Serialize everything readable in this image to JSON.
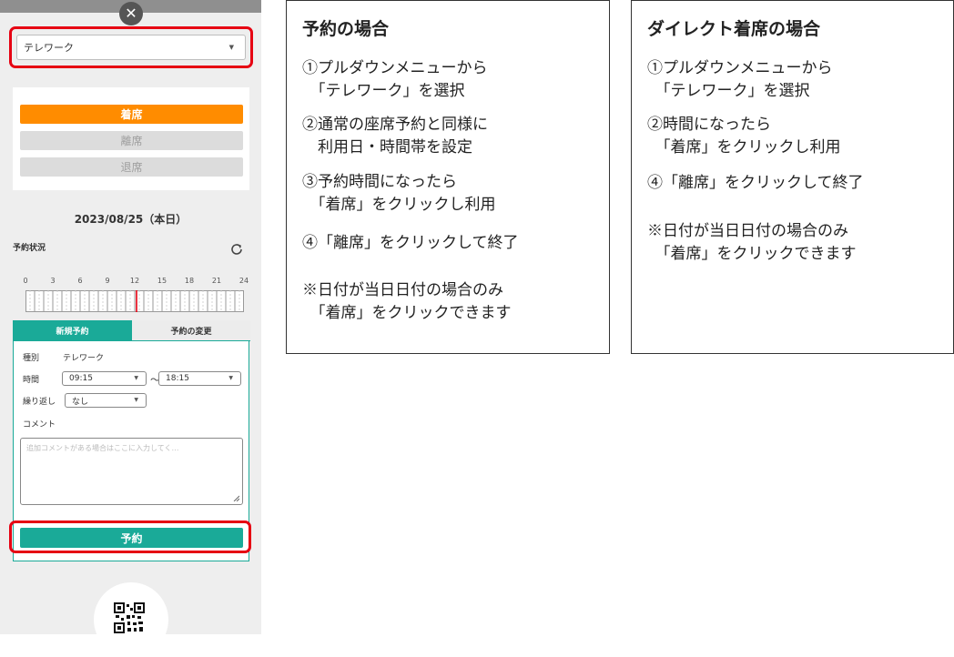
{
  "app": {
    "close_icon": "close-icon",
    "status_select": {
      "value": "テレワーク"
    },
    "seat_buttons": {
      "checkin": "着席",
      "leave": "離席",
      "exit": "退席"
    },
    "date": "2023/08/25（本日）",
    "reservation_status_heading": "予約状況",
    "timeline": {
      "ticks": [
        "0",
        "3",
        "6",
        "9",
        "12",
        "15",
        "18",
        "21",
        "24"
      ],
      "current_hour": 12.2
    },
    "tabs": {
      "new": "新規予約",
      "change": "予約の変更"
    },
    "form": {
      "type_label": "種別",
      "type_value": "テレワーク",
      "time_label": "時間",
      "start_time": "09:15",
      "tilde": "～",
      "end_time": "18:15",
      "repeat_label": "繰り返し",
      "repeat_value": "なし",
      "comment_label": "コメント",
      "comment_placeholder": "追加コメントがある場合はここに入力してく…"
    },
    "reserve_button": "予約",
    "qr_icon": "qr-code-icon"
  },
  "colors": {
    "accent_teal": "#1aaa98",
    "checkin_orange": "#ff8c00",
    "highlight_red": "#e60012"
  },
  "instructions": {
    "reservation": {
      "title": "予約の場合",
      "steps": [
        "①プルダウンメニューから\n　「テレワーク」を選択",
        "②通常の座席予約と同様に\n　利用日・時間帯を設定",
        "③予約時間になったら\n　「着席」をクリックし利用",
        "④「離席」をクリックして終了",
        "※日付が当日日付の場合のみ\n　「着席」をクリックできます"
      ]
    },
    "direct": {
      "title": "ダイレクト着席の場合",
      "steps": [
        "①プルダウンメニューから\n　「テレワーク」を選択",
        "②時間になったら\n　「着席」をクリックし利用",
        "④「離席」をクリックして終了",
        "※日付が当日日付の場合のみ\n　「着席」をクリックできます"
      ]
    }
  }
}
